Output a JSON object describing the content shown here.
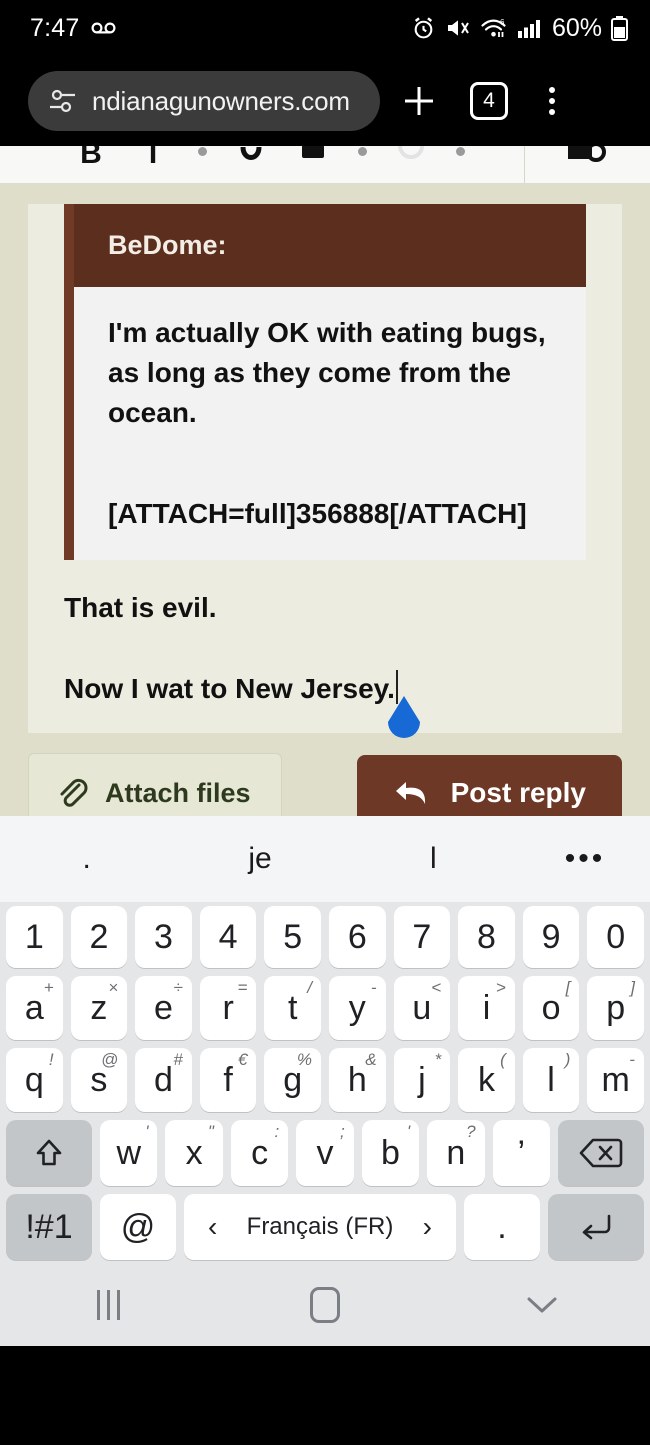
{
  "status_bar": {
    "time": "7:47",
    "voicemail_icon": "voicemail-icon",
    "alarm_icon": "alarm-icon",
    "mute_icon": "mute-icon",
    "wifi_icon": "wifi-icon",
    "signal_icon": "cellular-signal-icon",
    "battery_percent": "60%",
    "battery_icon": "battery-icon"
  },
  "browser": {
    "url": "ndianagunowners.com",
    "site_settings_icon": "site-settings-icon",
    "new_tab_label": "+",
    "tab_count": "4",
    "menu_icon": "overflow-menu-icon"
  },
  "editor_toolbar": {
    "bold": "B",
    "italic": "I",
    "link_icon": "link-icon",
    "list_icon": "list-icon",
    "circle_icon": "circle-icon",
    "preview_icon": "preview-icon"
  },
  "post": {
    "quote_author": "BeDome:",
    "quote_text": "I'm actually OK with eating bugs, as long as they come from the ocean.",
    "quote_attachment": "[ATTACH=full]356888[/ATTACH]",
    "reply_line_1": "That is evil.",
    "reply_line_2": "Now I wat to New Jersey.",
    "cursor_handle_icon": "text-cursor-handle-icon"
  },
  "actions": {
    "attach_label": "Attach files",
    "attach_icon": "paperclip-icon",
    "post_label": "Post reply",
    "post_icon": "reply-arrow-icon"
  },
  "keyboard": {
    "suggestions": [
      ".",
      "je",
      "l"
    ],
    "more_suggestions": "•••",
    "row_numbers": [
      "1",
      "2",
      "3",
      "4",
      "5",
      "6",
      "7",
      "8",
      "9",
      "0"
    ],
    "row1": [
      {
        "k": "a",
        "alt": "+"
      },
      {
        "k": "z",
        "alt": "×"
      },
      {
        "k": "e",
        "alt": "÷"
      },
      {
        "k": "r",
        "alt": "="
      },
      {
        "k": "t",
        "alt": "/"
      },
      {
        "k": "y",
        "alt": "-"
      },
      {
        "k": "u",
        "alt": "<"
      },
      {
        "k": "i",
        "alt": ">"
      },
      {
        "k": "o",
        "alt": "["
      },
      {
        "k": "p",
        "alt": "]"
      }
    ],
    "row2": [
      {
        "k": "q",
        "alt": "!"
      },
      {
        "k": "s",
        "alt": "@"
      },
      {
        "k": "d",
        "alt": "#"
      },
      {
        "k": "f",
        "alt": "€"
      },
      {
        "k": "g",
        "alt": "%"
      },
      {
        "k": "h",
        "alt": "&"
      },
      {
        "k": "j",
        "alt": "*"
      },
      {
        "k": "k",
        "alt": "("
      },
      {
        "k": "l",
        "alt": ")"
      },
      {
        "k": "m",
        "alt": "-"
      }
    ],
    "row3": [
      {
        "k": "w",
        "alt": "'"
      },
      {
        "k": "x",
        "alt": "\""
      },
      {
        "k": "c",
        "alt": ":"
      },
      {
        "k": "v",
        "alt": ";"
      },
      {
        "k": "b",
        "alt": "'"
      },
      {
        "k": "n",
        "alt": "?"
      },
      {
        "k": "’",
        "alt": ""
      }
    ],
    "shift_icon": "shift-icon",
    "backspace_icon": "backspace-icon",
    "symbols_label": "!#1",
    "at_label": "@",
    "space_language": "Français (FR)",
    "space_prev_icon": "chevron-left-icon",
    "space_next_icon": "chevron-right-icon",
    "period_label": ".",
    "enter_icon": "enter-icon"
  },
  "navbar": {
    "recents_icon": "recents-icon",
    "home_icon": "home-icon",
    "dismiss_keyboard_icon": "chevron-down-icon"
  },
  "colors": {
    "quote_header_brown": "#5b2e1d",
    "post_button_brown": "#6d3826",
    "page_beige": "#dedecb",
    "editor_cream": "#ecece0",
    "green_band": "#4d5326",
    "cursor_blue": "#1769d6"
  }
}
